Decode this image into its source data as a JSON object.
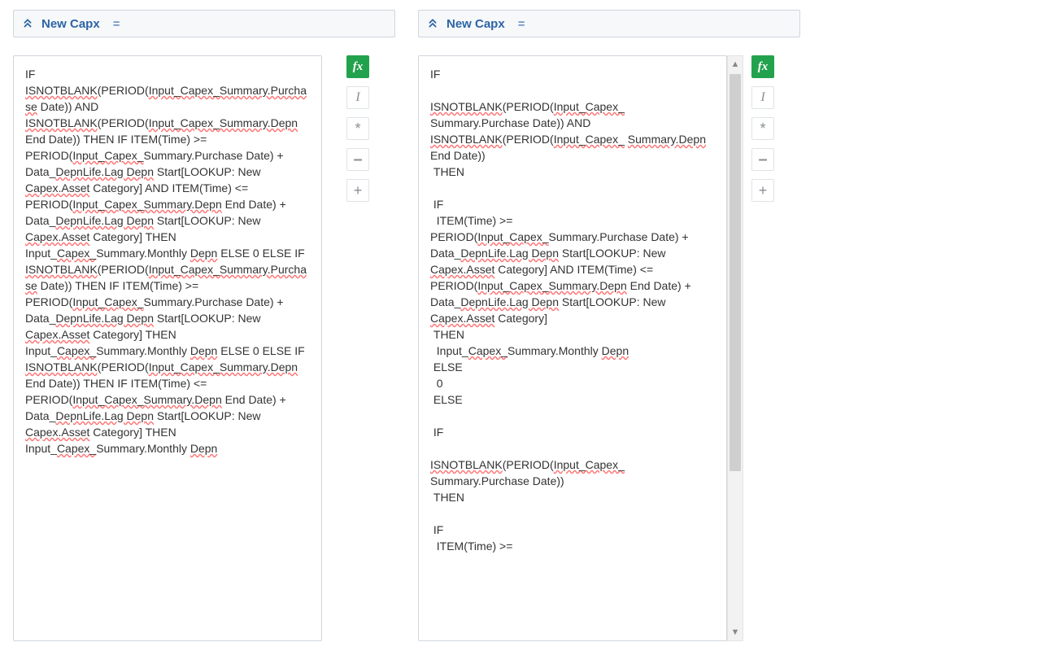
{
  "left": {
    "title": "New Capx",
    "equals": "=",
    "formula_segments": [
      {
        "t": "IF "
      },
      {
        "t": "ISNOTBLANK",
        "w": true
      },
      {
        "t": "(PERIOD("
      },
      {
        "t": "Input_Capex_Summary.Purchase",
        "w": true
      },
      {
        "t": " Date)) AND "
      },
      {
        "t": "ISNOTBLANK",
        "w": true
      },
      {
        "t": "(PERIOD("
      },
      {
        "t": "Input_Capex_Summary.Depn",
        "w": true
      },
      {
        "t": " End Date)) THEN IF ITEM(Time) >= PERIOD("
      },
      {
        "t": "Input_Capex_",
        "w": true
      },
      {
        "t": "Summary.Purchase Date) + Data_"
      },
      {
        "t": "DepnLife.Lag Depn",
        "w": true
      },
      {
        "t": " Start[LOOKUP: New "
      },
      {
        "t": "Capex.Asset",
        "w": true
      },
      {
        "t": " Category] AND ITEM(Time) <= PERIOD("
      },
      {
        "t": "Input_Capex_Summary.Depn",
        "w": true
      },
      {
        "t": " End Date) + Data_"
      },
      {
        "t": "DepnLife.Lag Depn",
        "w": true
      },
      {
        "t": " Start[LOOKUP: New "
      },
      {
        "t": "Capex.Asset",
        "w": true
      },
      {
        "t": " Category] THEN Input_"
      },
      {
        "t": "Capex_",
        "w": true
      },
      {
        "t": "Summary.Monthly "
      },
      {
        "t": "Depn",
        "w": true
      },
      {
        "t": " ELSE 0 ELSE IF "
      },
      {
        "t": "ISNOTBLANK",
        "w": true
      },
      {
        "t": "(PERIOD("
      },
      {
        "t": "Input_Capex_Summary.Purchase",
        "w": true
      },
      {
        "t": " Date)) THEN IF ITEM(Time) >= PERIOD("
      },
      {
        "t": "Input_Capex_",
        "w": true
      },
      {
        "t": "Summary.Purchase Date) + Data_"
      },
      {
        "t": "DepnLife.Lag Depn",
        "w": true
      },
      {
        "t": " Start[LOOKUP: New "
      },
      {
        "t": "Capex.Asset",
        "w": true
      },
      {
        "t": " Category] THEN Input_"
      },
      {
        "t": "Capex_",
        "w": true
      },
      {
        "t": "Summary.Monthly "
      },
      {
        "t": "Depn",
        "w": true
      },
      {
        "t": " ELSE 0 ELSE IF "
      },
      {
        "t": "ISNOTBLANK",
        "w": true
      },
      {
        "t": "(PERIOD("
      },
      {
        "t": "Input_Capex_Summary.Depn",
        "w": true
      },
      {
        "t": " End Date)) THEN IF ITEM(Time) <= PERIOD("
      },
      {
        "t": "Input_Capex_Summary.Depn",
        "w": true
      },
      {
        "t": " End Date) + Data_"
      },
      {
        "t": "DepnLife.Lag Depn",
        "w": true
      },
      {
        "t": " Start[LOOKUP: New "
      },
      {
        "t": "Capex.Asset",
        "w": true
      },
      {
        "t": " Category] THEN Input_"
      },
      {
        "t": "Capex_",
        "w": true
      },
      {
        "t": "Summary.Monthly "
      },
      {
        "t": "Depn",
        "w": true
      }
    ]
  },
  "right": {
    "title": "New Capx",
    "equals": "=",
    "formula_lines": [
      [
        {
          "t": "IF"
        }
      ],
      [
        {
          "t": ""
        }
      ],
      [
        {
          "t": "ISNOTBLANK",
          "w": true
        },
        {
          "t": "(PERIOD("
        },
        {
          "t": "Input_Capex_",
          "w": true
        },
        {
          "t": " Summary.Purchase Date)) AND "
        },
        {
          "t": "ISNOTBLANK",
          "w": true
        },
        {
          "t": "(PERIOD("
        },
        {
          "t": "Input_Capex_",
          "w": true
        },
        {
          "t": " "
        },
        {
          "t": "Summary.Depn",
          "w": true
        },
        {
          "t": " End Date))"
        }
      ],
      [
        {
          "t": " THEN"
        }
      ],
      [
        {
          "t": ""
        }
      ],
      [
        {
          "t": " IF"
        }
      ],
      [
        {
          "t": "  ITEM(Time) >="
        }
      ],
      [
        {
          "t": "PERIOD("
        },
        {
          "t": "Input_Capex_",
          "w": true
        },
        {
          "t": "Summary.Purchase Date) + Data_"
        },
        {
          "t": "DepnLife.Lag Depn",
          "w": true
        },
        {
          "t": " Start[LOOKUP: New "
        },
        {
          "t": "Capex.Asset",
          "w": true
        },
        {
          "t": " Category] AND ITEM(Time) <= PERIOD("
        },
        {
          "t": "Input_Capex_Summary.Depn",
          "w": true
        },
        {
          "t": " End Date) + Data_"
        },
        {
          "t": "DepnLife.Lag Depn",
          "w": true
        },
        {
          "t": " Start[LOOKUP: New "
        },
        {
          "t": "Capex.Asset",
          "w": true
        },
        {
          "t": " Category]"
        }
      ],
      [
        {
          "t": " THEN"
        }
      ],
      [
        {
          "t": "  Input_"
        },
        {
          "t": "Capex_",
          "w": true
        },
        {
          "t": "Summary.Monthly "
        },
        {
          "t": "Depn",
          "w": true
        }
      ],
      [
        {
          "t": " ELSE"
        }
      ],
      [
        {
          "t": "  0"
        }
      ],
      [
        {
          "t": " ELSE"
        }
      ],
      [
        {
          "t": ""
        }
      ],
      [
        {
          "t": " IF"
        }
      ],
      [
        {
          "t": ""
        }
      ],
      [
        {
          "t": "ISNOTBLANK",
          "w": true
        },
        {
          "t": "(PERIOD("
        },
        {
          "t": "Input_Capex_",
          "w": true
        },
        {
          "t": " Summary.Purchase Date))"
        }
      ],
      [
        {
          "t": " THEN"
        }
      ],
      [
        {
          "t": ""
        }
      ],
      [
        {
          "t": " IF"
        }
      ],
      [
        {
          "t": "  ITEM(Time) >="
        }
      ]
    ]
  },
  "toolbar": {
    "fx": "fx",
    "italic": "I",
    "star": "*",
    "minus": "–",
    "plus": "+"
  }
}
